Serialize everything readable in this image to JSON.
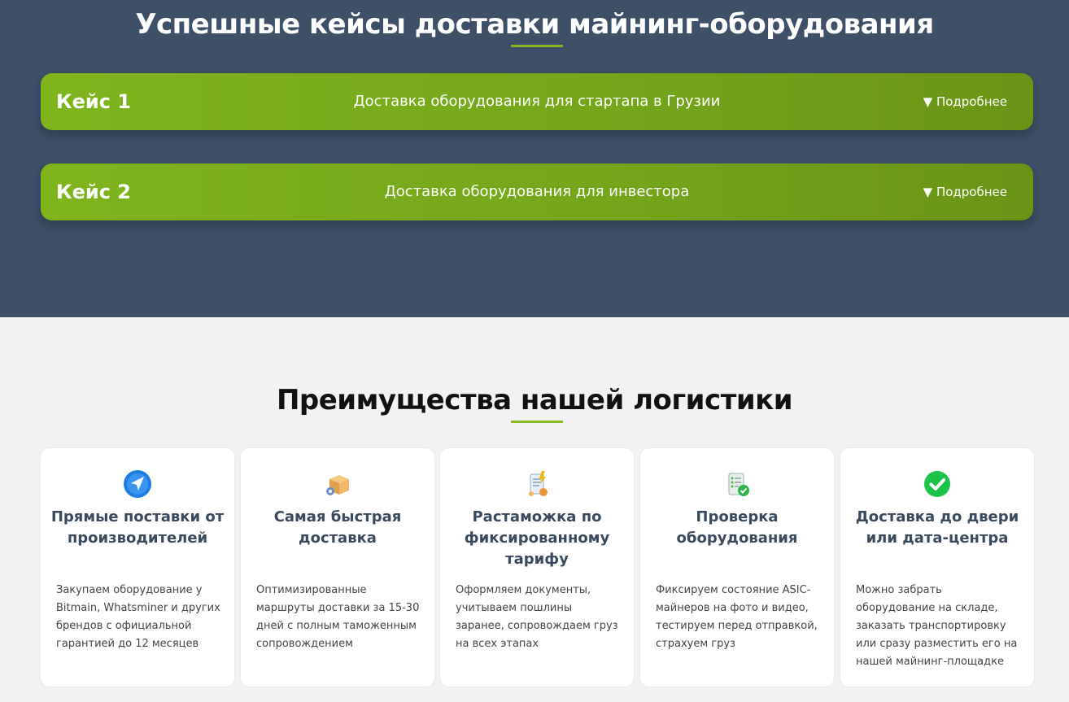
{
  "cases_section": {
    "title": "Успешные кейсы доставки майнинг-оборудования",
    "items": [
      {
        "num": "Кейс 1",
        "desc": "Доставка оборудования для стартапа в Грузии",
        "more": "▼ Подробнее"
      },
      {
        "num": "Кейс 2",
        "desc": "Доставка оборудования для инвестора",
        "more": "▼ Подробнее"
      }
    ]
  },
  "advantages_section": {
    "title": "Преимущества нашей логистики",
    "cards": [
      {
        "icon": "direct-delivery-icon",
        "title": "Прямые поставки от производителей",
        "text": "Закупаем оборудование у Bitmain, Whatsminer и других брендов с официальной гарантией до 12 месяцев"
      },
      {
        "icon": "fast-delivery-icon",
        "title": "Самая быстрая доставка",
        "text": "Оптимизированные маршруты доставки за 15-30 дней с полным таможенным сопровождением"
      },
      {
        "icon": "customs-document-icon",
        "title": "Растаможка по фиксированному тарифу",
        "text": "Оформляем документы, учитываем пошлины заранее, сопровождаем груз на всех этапах"
      },
      {
        "icon": "checklist-icon",
        "title": "Проверка оборудования",
        "text": "Фиксируем состояние ASIC-майнеров на фото и видео, тестируем перед отправкой, страхуем груз"
      },
      {
        "icon": "check-circle-icon",
        "title": "Доставка до двери или дата-центра",
        "text": "Можно забрать оборудование на складе, заказать транспортировку или сразу разместить его на нашей майнинг-площадке"
      }
    ]
  },
  "colors": {
    "header_bg": "#3d5068",
    "accent_green": "#7eb51c",
    "page_bg": "#f2f2f2"
  }
}
